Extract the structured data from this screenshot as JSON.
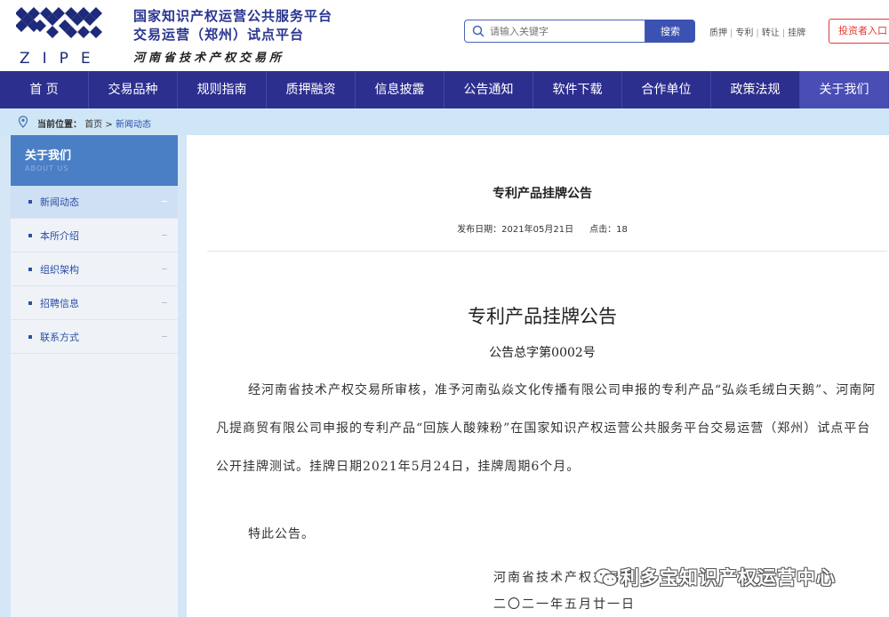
{
  "header": {
    "logo_text": "ZIPE",
    "title_line1": "国家知识产权运营公共服务平台",
    "title_line2": "交易运营（郑州）试点平台",
    "title_line3": "河南省技术产权交易所",
    "search_placeholder": "请输入关键字",
    "search_button": "搜索",
    "quick_links": [
      "质押",
      "专利",
      "转让",
      "挂牌"
    ],
    "investor_button": "投资者入口"
  },
  "nav": {
    "items": [
      "首 页",
      "交易品种",
      "规则指南",
      "质押融资",
      "信息披露",
      "公告通知",
      "软件下载",
      "合作单位",
      "政策法规",
      "关于我们"
    ]
  },
  "breadcrumb": {
    "label": "当前位置：",
    "home": "首页",
    "separator": ">",
    "current": "新闻动态"
  },
  "sidebar": {
    "title": "关于我们",
    "subtitle": "ABOUT US",
    "items": [
      "新闻动态",
      "本所介绍",
      "组织架构",
      "招聘信息",
      "联系方式"
    ]
  },
  "article": {
    "title": "专利产品挂牌公告",
    "date_label": "发布日期：",
    "date": "2021年05月21日",
    "clicks_label": "点击：",
    "clicks": "18"
  },
  "document": {
    "title": "专利产品挂牌公告",
    "number": "公告总字第0002号",
    "body": "经河南省技术产权交易所审核，准予河南弘焱文化传播有限公司申报的专利产品“弘焱毛绒白天鹅”、河南阿凡提商贸有限公司申报的专利产品“回族人酸辣粉”在国家知识产权运营公共服务平台交易运营（郑州）试点平台公开挂牌测试。挂牌日期2021年5月24日，挂牌周期6个月。",
    "note": "特此公告。",
    "signature": "河南省技术产权交易所",
    "sign_date": "二〇二一年五月廿一日"
  },
  "watermark": {
    "text": "利多宝知识产权运营中心"
  },
  "colors": {
    "nav_bg": "#2d2f8f",
    "brand_blue": "#2a3590",
    "sidebar_head": "#4a7fc6",
    "breadcrumb_bg": "#cfe6f7",
    "investor_red": "#e53935"
  }
}
